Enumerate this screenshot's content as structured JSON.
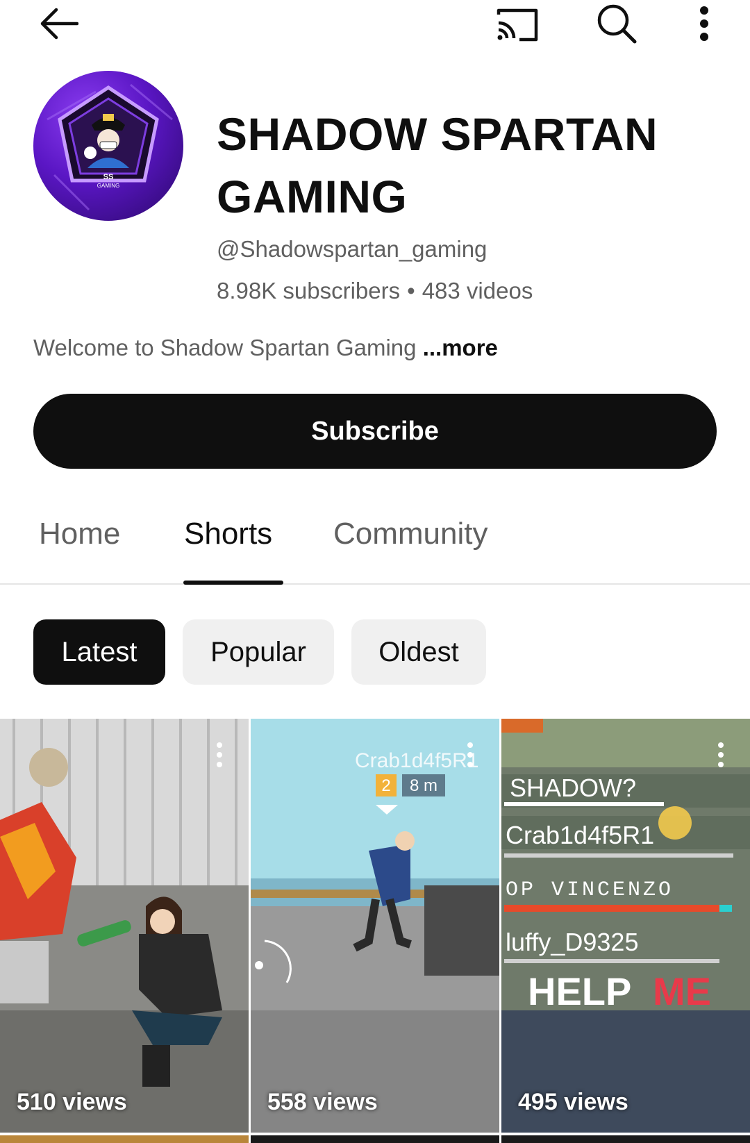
{
  "channel": {
    "title": "SHADOW SPARTAN GAMING",
    "handle": "@Shadowspartan_gaming",
    "subscribers": "8.98K subscribers",
    "videos": "483 videos",
    "separator": "•",
    "description": "Welcome to Shadow Spartan Gaming ",
    "more_label": "...more",
    "subscribe_label": "Subscribe",
    "avatar": {
      "badge_text": "SS",
      "sub_text": "GAMING"
    }
  },
  "tabs": [
    {
      "label": "Home",
      "active": false
    },
    {
      "label": "Shorts",
      "active": true
    },
    {
      "label": "Community",
      "active": false
    }
  ],
  "chips": [
    {
      "label": "Latest",
      "active": true
    },
    {
      "label": "Popular",
      "active": false
    },
    {
      "label": "Oldest",
      "active": false
    }
  ],
  "shorts": [
    {
      "views": "510 views"
    },
    {
      "views": "558 views",
      "overlay": {
        "name": "Crab1d4f5R1",
        "rank": "2",
        "distance": "8 m"
      }
    },
    {
      "views": "495 views",
      "overlay": {
        "lines": [
          "SHADOW?",
          "Crab1d4f5R1",
          "OP VINCENZO",
          "luffy_D9325"
        ],
        "help": "HELP",
        "me": "ME"
      }
    }
  ],
  "icons": {
    "back": "arrow-left-icon",
    "cast": "cast-icon",
    "search": "search-icon",
    "more": "more-vertical-icon"
  },
  "colors": {
    "primary": "#0f0f0f",
    "secondary_text": "#606060",
    "chip_bg": "#f0f0f0",
    "divider": "#e5e5e5"
  }
}
